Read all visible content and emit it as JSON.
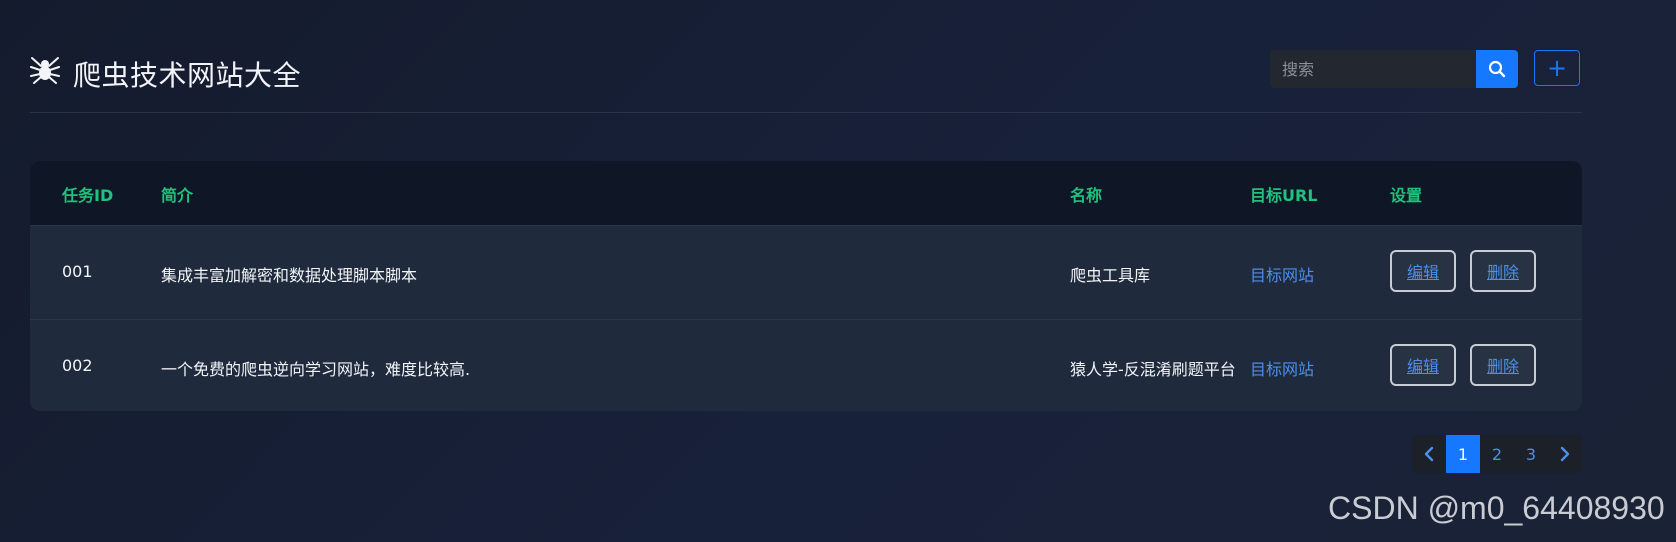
{
  "header": {
    "logo_icon": "spider-icon",
    "title": "爬虫技术网站大全",
    "search": {
      "placeholder": "搜索",
      "value": "",
      "button_icon": "search-icon"
    },
    "add_button": {
      "label": "+"
    }
  },
  "table": {
    "columns": [
      "任务ID",
      "简介",
      "名称",
      "目标URL",
      "设置"
    ],
    "rows": [
      {
        "id": "001",
        "description": "集成丰富加解密和数据处理脚本脚本",
        "name": "爬虫工具库",
        "target": "目标网站",
        "edit": "编辑",
        "delete": "删除"
      },
      {
        "id": "002",
        "description": "一个免费的爬虫逆向学习网站，难度比较高.",
        "name": "猿人学-反混淆刷题平台",
        "target": "目标网站",
        "edit": "编辑",
        "delete": "删除"
      }
    ]
  },
  "pagination": {
    "prev_icon": "chevron-left-icon",
    "pages": [
      "1",
      "2",
      "3"
    ],
    "current": "1",
    "next_icon": "chevron-right-icon"
  },
  "watermark": "CSDN @m0_64408930",
  "colors": {
    "accent": "#1677ff",
    "header_text": "#1fc17c",
    "link": "#4d8fe9"
  }
}
